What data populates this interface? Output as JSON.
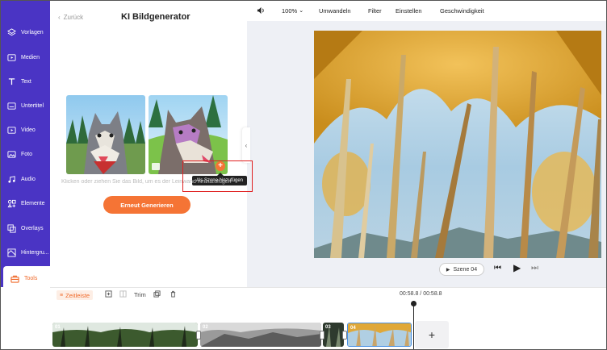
{
  "sidebar": {
    "items": [
      {
        "label": "Vorlagen",
        "icon": "layers-icon"
      },
      {
        "label": "Medien",
        "icon": "media-icon"
      },
      {
        "label": "Text",
        "icon": "text-icon"
      },
      {
        "label": "Untertitel",
        "icon": "subtitle-icon"
      },
      {
        "label": "Video",
        "icon": "video-icon"
      },
      {
        "label": "Foto",
        "icon": "photo-icon"
      },
      {
        "label": "Audio",
        "icon": "audio-icon"
      },
      {
        "label": "Elemente",
        "icon": "elements-icon"
      },
      {
        "label": "Overlays",
        "icon": "overlays-icon"
      },
      {
        "label": "Hintergru...",
        "icon": "background-icon"
      },
      {
        "label": "Tools",
        "icon": "toolbox-icon",
        "active": true
      }
    ]
  },
  "panel": {
    "back_label": "Zurück",
    "title": "KI Bildgenerator",
    "hint": "Klicken oder ziehen Sie das Bild, um es der Leinwand hinzuzufügen",
    "regen_label": "Erneut Generieren",
    "tooltip": "Als Szene hinzufügen",
    "add_symbol": "+"
  },
  "toolbar": {
    "zoom": "100%",
    "convert": "Umwandeln",
    "filter": "Filter",
    "settings": "Einstellen",
    "speed": "Geschwindigkeit"
  },
  "player": {
    "scene_label": "Szene 04"
  },
  "timeline": {
    "label": "Zeitleiste",
    "trim": "Trim",
    "time": "00:58.8 / 00:58.8",
    "add": "+",
    "clips": [
      "01",
      "02",
      "03",
      "04"
    ]
  },
  "colors": {
    "sidebar": "#4a34c4",
    "accent": "#f57435",
    "highlight": "#e02020"
  }
}
